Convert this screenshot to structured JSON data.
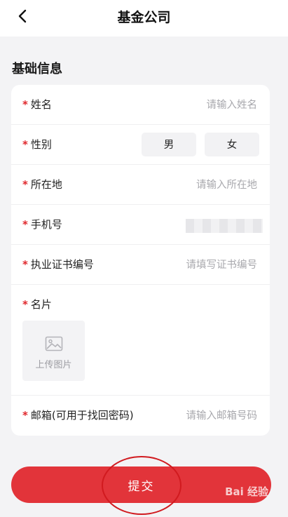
{
  "header": {
    "title": "基金公司"
  },
  "section": {
    "title": "基础信息"
  },
  "form": {
    "required_mark": "*",
    "name": {
      "label": "姓名",
      "placeholder": "请输入姓名"
    },
    "gender": {
      "label": "性别",
      "option_male": "男",
      "option_female": "女"
    },
    "location": {
      "label": "所在地",
      "placeholder": "请输入所在地"
    },
    "phone": {
      "label": "手机号"
    },
    "license": {
      "label": "执业证书编号",
      "placeholder": "请填写证书编号"
    },
    "card": {
      "label": "名片",
      "upload_label": "上传图片"
    },
    "email": {
      "label": "邮箱(可用于找回密码)",
      "placeholder": "请输入邮箱号码"
    }
  },
  "submit": {
    "label": "提交"
  },
  "watermark": {
    "text": "Bai 经验"
  },
  "colors": {
    "accent": "#e2343a",
    "required": "#e0262b"
  }
}
